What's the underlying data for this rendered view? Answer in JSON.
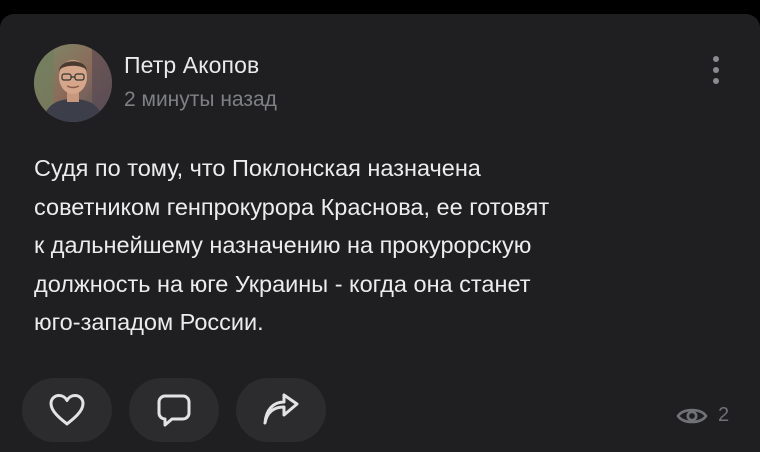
{
  "post": {
    "author_name": "Петр Акопов",
    "time": "2 минуты назад",
    "text": "Судя по тому, что Поклонская назначена\nсоветником генпрокурора Краснова, ее готовят\nк дальнейшему назначению на прокурорскую\nдолжность на юге Украины - когда она станет\nюго-западом России."
  },
  "actions": {
    "like_icon": "heart-icon",
    "comment_icon": "comment-icon",
    "share_icon": "share-arrow-icon"
  },
  "stats": {
    "views_icon": "eye-icon",
    "views_count": "2"
  },
  "colors": {
    "background": "#000000",
    "card": "#1f1f21",
    "button": "#2c2c2f",
    "text_primary": "#ececed",
    "text_secondary": "#7f8083"
  }
}
